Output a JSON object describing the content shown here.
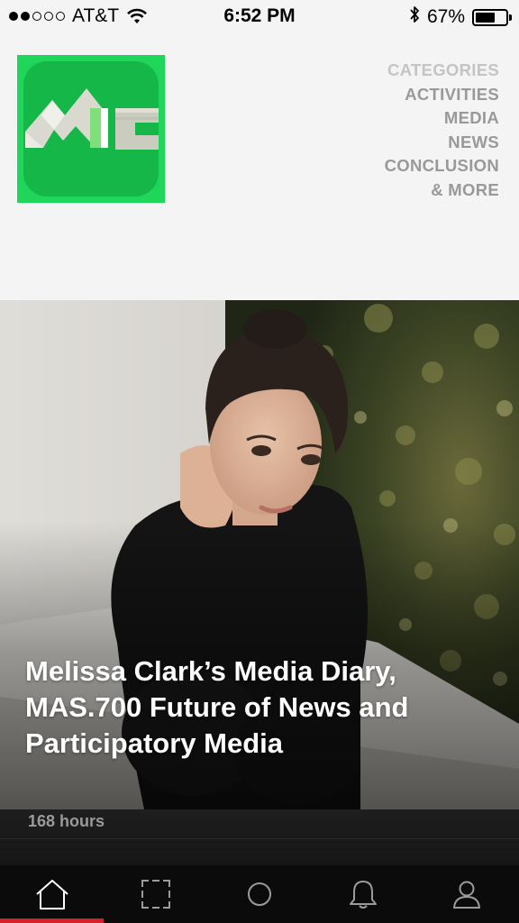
{
  "status_bar": {
    "carrier": "AT&T",
    "time": "6:52 PM",
    "battery_percent": "67%",
    "battery_level": 0.67,
    "signal_bars_filled": 2,
    "signal_bars_total": 5
  },
  "header": {
    "logo_icon": "abc-logo-icon",
    "logo_colors": {
      "outer": "#1fd65a",
      "inner": "#15b848"
    },
    "nav": {
      "heading": "CATEGORIES",
      "items": [
        {
          "label": "ACTIVITIES"
        },
        {
          "label": "MEDIA"
        },
        {
          "label": "NEWS"
        },
        {
          "label": "CONCLUSION"
        },
        {
          "label": "& MORE"
        }
      ]
    }
  },
  "hero": {
    "title": "Melissa Clark’s Media Diary, MAS.700 Future of News and Participatory Media"
  },
  "meta": {
    "duration": "168 hours"
  },
  "tab_bar": {
    "accent_color": "#d61f26",
    "tabs": [
      {
        "icon": "home-icon",
        "active": true
      },
      {
        "icon": "frame-icon",
        "active": false
      },
      {
        "icon": "circle-icon",
        "active": false
      },
      {
        "icon": "bell-icon",
        "active": false
      },
      {
        "icon": "profile-icon",
        "active": false
      }
    ]
  }
}
